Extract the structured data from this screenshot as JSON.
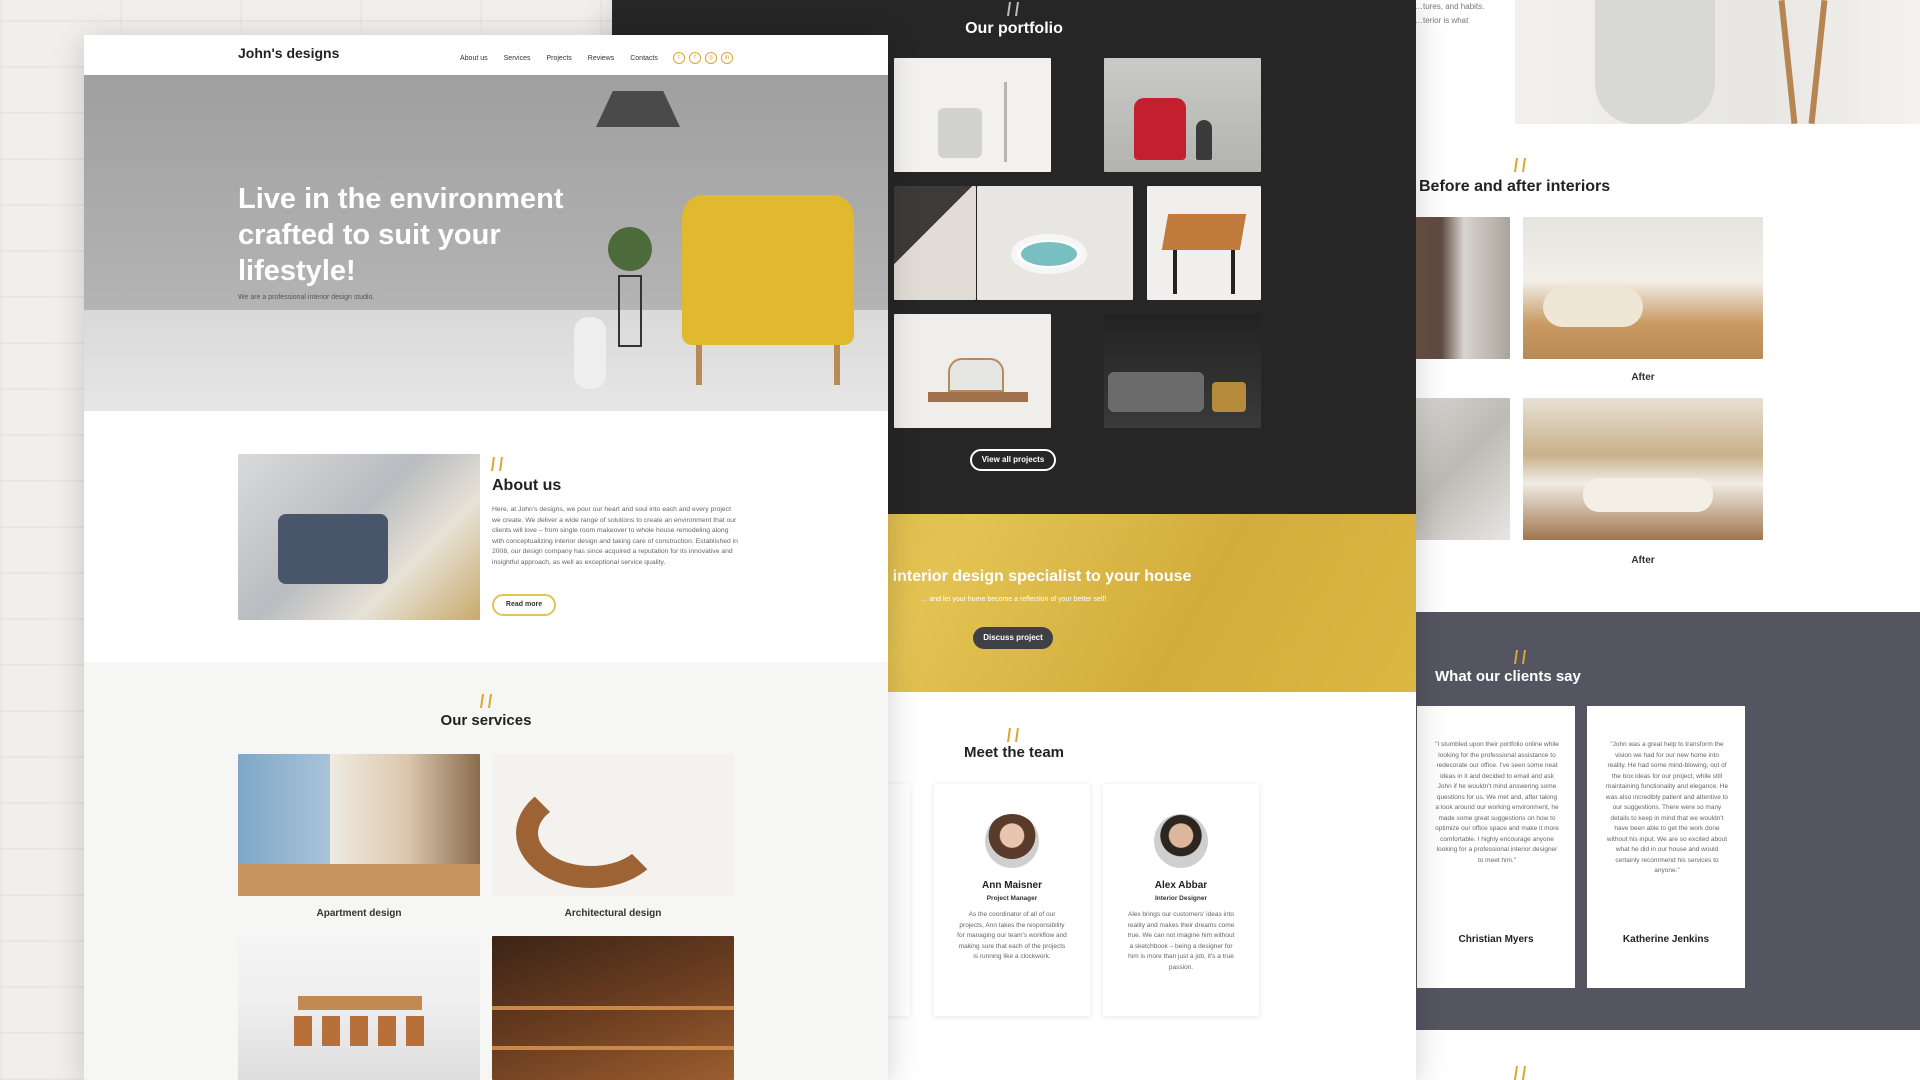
{
  "left_page": {
    "brand": "John's designs",
    "nav": [
      "About us",
      "Services",
      "Projects",
      "Reviews",
      "Contacts"
    ],
    "social_icons": [
      "twitter-icon",
      "facebook-icon",
      "instagram-icon",
      "linkedin-icon"
    ],
    "hero_title": "Live in the environment crafted to suit your lifestyle!",
    "hero_subtitle": "We are a professional interior design studio.",
    "about_title": "About us",
    "about_text": "Here, at John's designs, we pour our heart and soul into each and every project we create. We deliver a wide range of solutions to create an environment that our clients will love – from single room makeover to whole house remodeling along with conceptualizing interior design and taking care of construction. Established in 2008, our design company has since acquired a reputation for its innovative and insightful approach, as well as exceptional service quality.",
    "read_more": "Read more",
    "services_title": "Our services",
    "services": [
      "Apartment design",
      "Architectural design"
    ]
  },
  "middle_page": {
    "portfolio_title": "Our portfolio",
    "view_all": "View all projects",
    "banner_title": "r interior design specialist to your house",
    "banner_subtitle": "... and let your home become a reflection of your better self!",
    "discuss": "Discuss project",
    "team_title": "Meet the team",
    "team": [
      {
        "name": "Ann Maisner",
        "role": "Project Manager",
        "bio": "As the coordinator of all of our projects, Ann takes the responsibility for managing our team's workflow and making sure that each of the projects is running like a clockwork."
      },
      {
        "name": "Alex Abbar",
        "role": "Interior Designer",
        "bio": "Alex brings our customers' ideas into reality and makes their dreams come true. We can not imagine him without a sketchbook – being a designer for him is more than just a job, it's a true passion."
      }
    ]
  },
  "right_page": {
    "top_text": "…tures, and habits.\n…terior is what",
    "before_after_title": "Before and after interiors",
    "after_labels": [
      "After",
      "After"
    ],
    "clients_title": "What our clients say",
    "testimonials": [
      {
        "name": "Christian Myers",
        "text": "\"I stumbled upon their portfolio online while looking for the professional assistance to redecorate our office. I've seen some neat ideas in it and decided to email and ask John if he wouldn't mind answering some questions for us. We met and, after taking a look around our working environment, he made some great suggestions on how to optimize our office space and make it more comfortable. I highly encourage anyone looking for a professional interior designer to meet him.\""
      },
      {
        "name": "Katherine Jenkins",
        "text": "\"John was a great help to transform the vision we had for our new home into reality. He had some mind-blowing, out of the box ideas for our project, while still maintaining functionality and elegance. He was also incredibly patient and attentive to our suggestions. There were so many details to keep in mind that we wouldn't have been able to get the work done without his input. We are so excited about what he did in our house and would certainly recommend his services to anyone.\""
      }
    ]
  },
  "colors": {
    "accent": "#d9a82b",
    "dark": "#262626",
    "banner": "#dcb642",
    "slate": "#545561"
  }
}
